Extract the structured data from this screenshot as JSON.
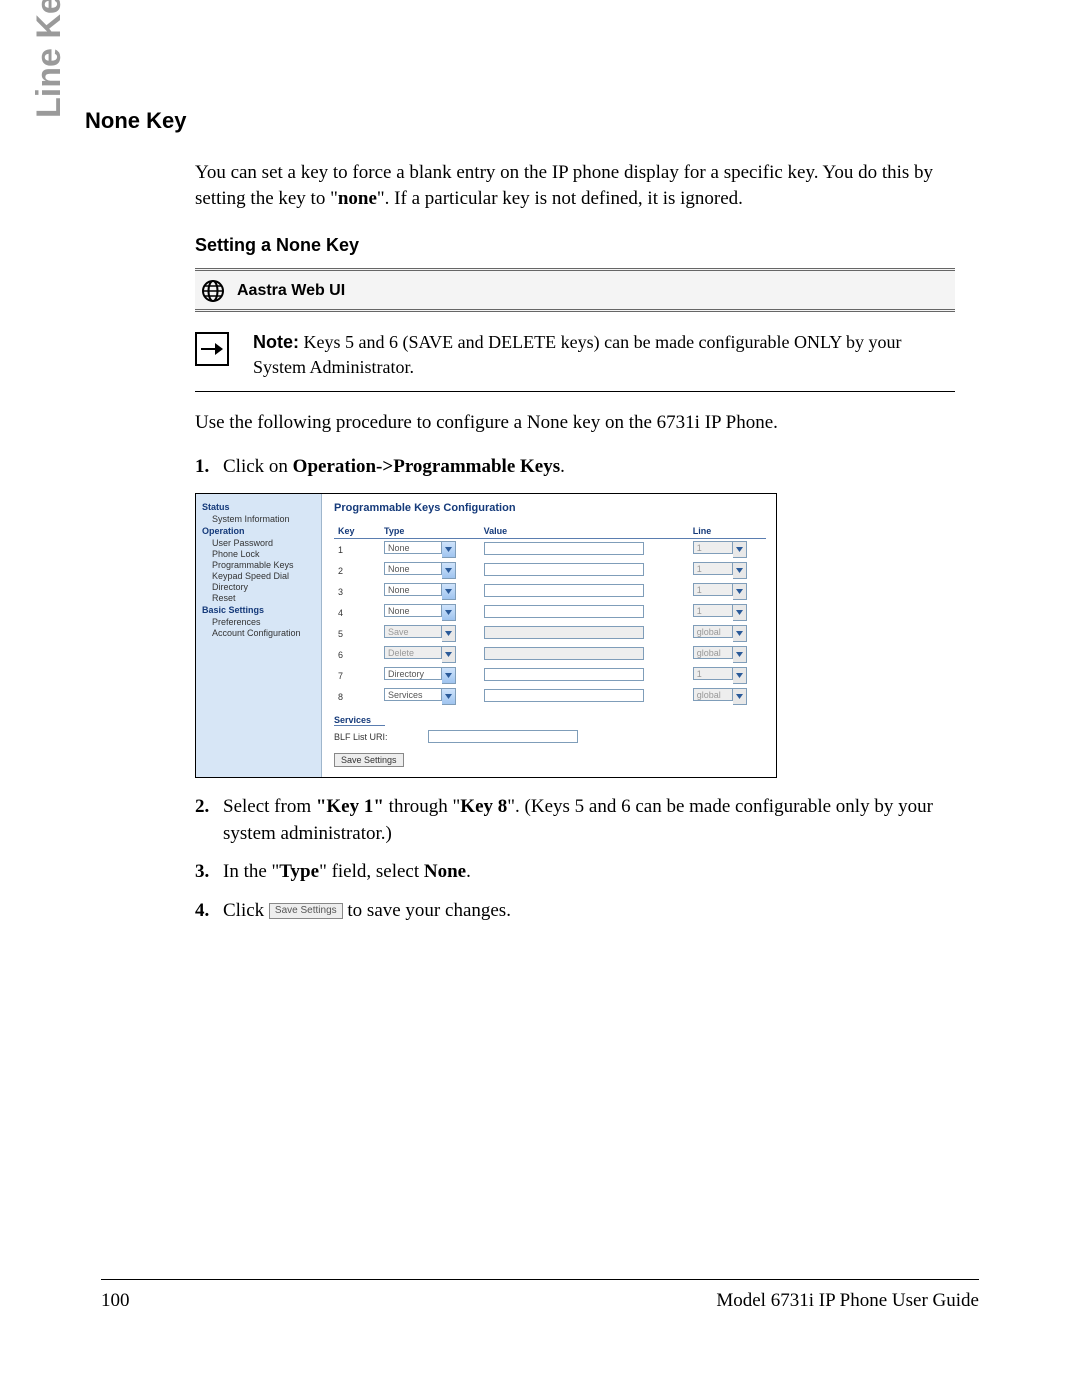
{
  "sidebar_label": "Line Keys and Programmable Keys",
  "heading": "None Key",
  "intro_pre": "You can set a key to force a blank entry on the IP phone display for a specific key. You do this by setting the key to \"",
  "intro_bold": "none",
  "intro_post": "\". If a particular key is not defined, it is ignored.",
  "subheading": "Setting a None Key",
  "webui_label": "Aastra Web UI",
  "note": {
    "label": "Note:",
    "text": " Keys 5 and 6 (SAVE and DELETE keys) can be made configurable ONLY by your System Administrator."
  },
  "procedure_lead": "Use the following procedure to configure a None key on the 6731i IP Phone.",
  "steps": {
    "s1_pre": "Click on ",
    "s1_bold": "Operation->Programmable Keys",
    "s1_post": ".",
    "s2_pre": "Select from ",
    "s2_b1": "\"Key 1\"",
    "s2_mid": " through \"",
    "s2_b2": "Key 8",
    "s2_post": "\". (Keys 5 and 6 can be made configurable only by your system administrator.)",
    "s3_pre": "In the \"",
    "s3_b1": "Type",
    "s3_mid": "\" field, select ",
    "s3_b2": "None",
    "s3_post": ".",
    "s4_pre": "Click ",
    "s4_btn": "Save Settings",
    "s4_post": " to save your changes."
  },
  "ui": {
    "nav": {
      "status": "Status",
      "sysinfo": "System Information",
      "operation": "Operation",
      "userpw": "User Password",
      "phonelock": "Phone Lock",
      "progkeys": "Programmable Keys",
      "keypad": "Keypad Speed Dial",
      "directory": "Directory",
      "reset": "Reset",
      "basic": "Basic Settings",
      "prefs": "Preferences",
      "acct": "Account Configuration"
    },
    "title": "Programmable Keys Configuration",
    "cols": {
      "key": "Key",
      "type": "Type",
      "value": "Value",
      "line": "Line"
    },
    "rows": [
      {
        "key": "1",
        "type": "None",
        "type_disabled": false,
        "value_disabled": false,
        "line": "1",
        "line_disabled": true
      },
      {
        "key": "2",
        "type": "None",
        "type_disabled": false,
        "value_disabled": false,
        "line": "1",
        "line_disabled": true
      },
      {
        "key": "3",
        "type": "None",
        "type_disabled": false,
        "value_disabled": false,
        "line": "1",
        "line_disabled": true
      },
      {
        "key": "4",
        "type": "None",
        "type_disabled": false,
        "value_disabled": false,
        "line": "1",
        "line_disabled": true
      },
      {
        "key": "5",
        "type": "Save",
        "type_disabled": true,
        "value_disabled": true,
        "line": "global",
        "line_disabled": true
      },
      {
        "key": "6",
        "type": "Delete",
        "type_disabled": true,
        "value_disabled": true,
        "line": "global",
        "line_disabled": true
      },
      {
        "key": "7",
        "type": "Directory",
        "type_disabled": false,
        "value_disabled": false,
        "line": "1",
        "line_disabled": true
      },
      {
        "key": "8",
        "type": "Services",
        "type_disabled": false,
        "value_disabled": false,
        "line": "global",
        "line_disabled": true
      }
    ],
    "services_label": "Services",
    "blf_label": "BLF List URI:",
    "save_settings": "Save Settings"
  },
  "footer": {
    "page": "100",
    "title": "Model 6731i IP Phone User Guide"
  }
}
